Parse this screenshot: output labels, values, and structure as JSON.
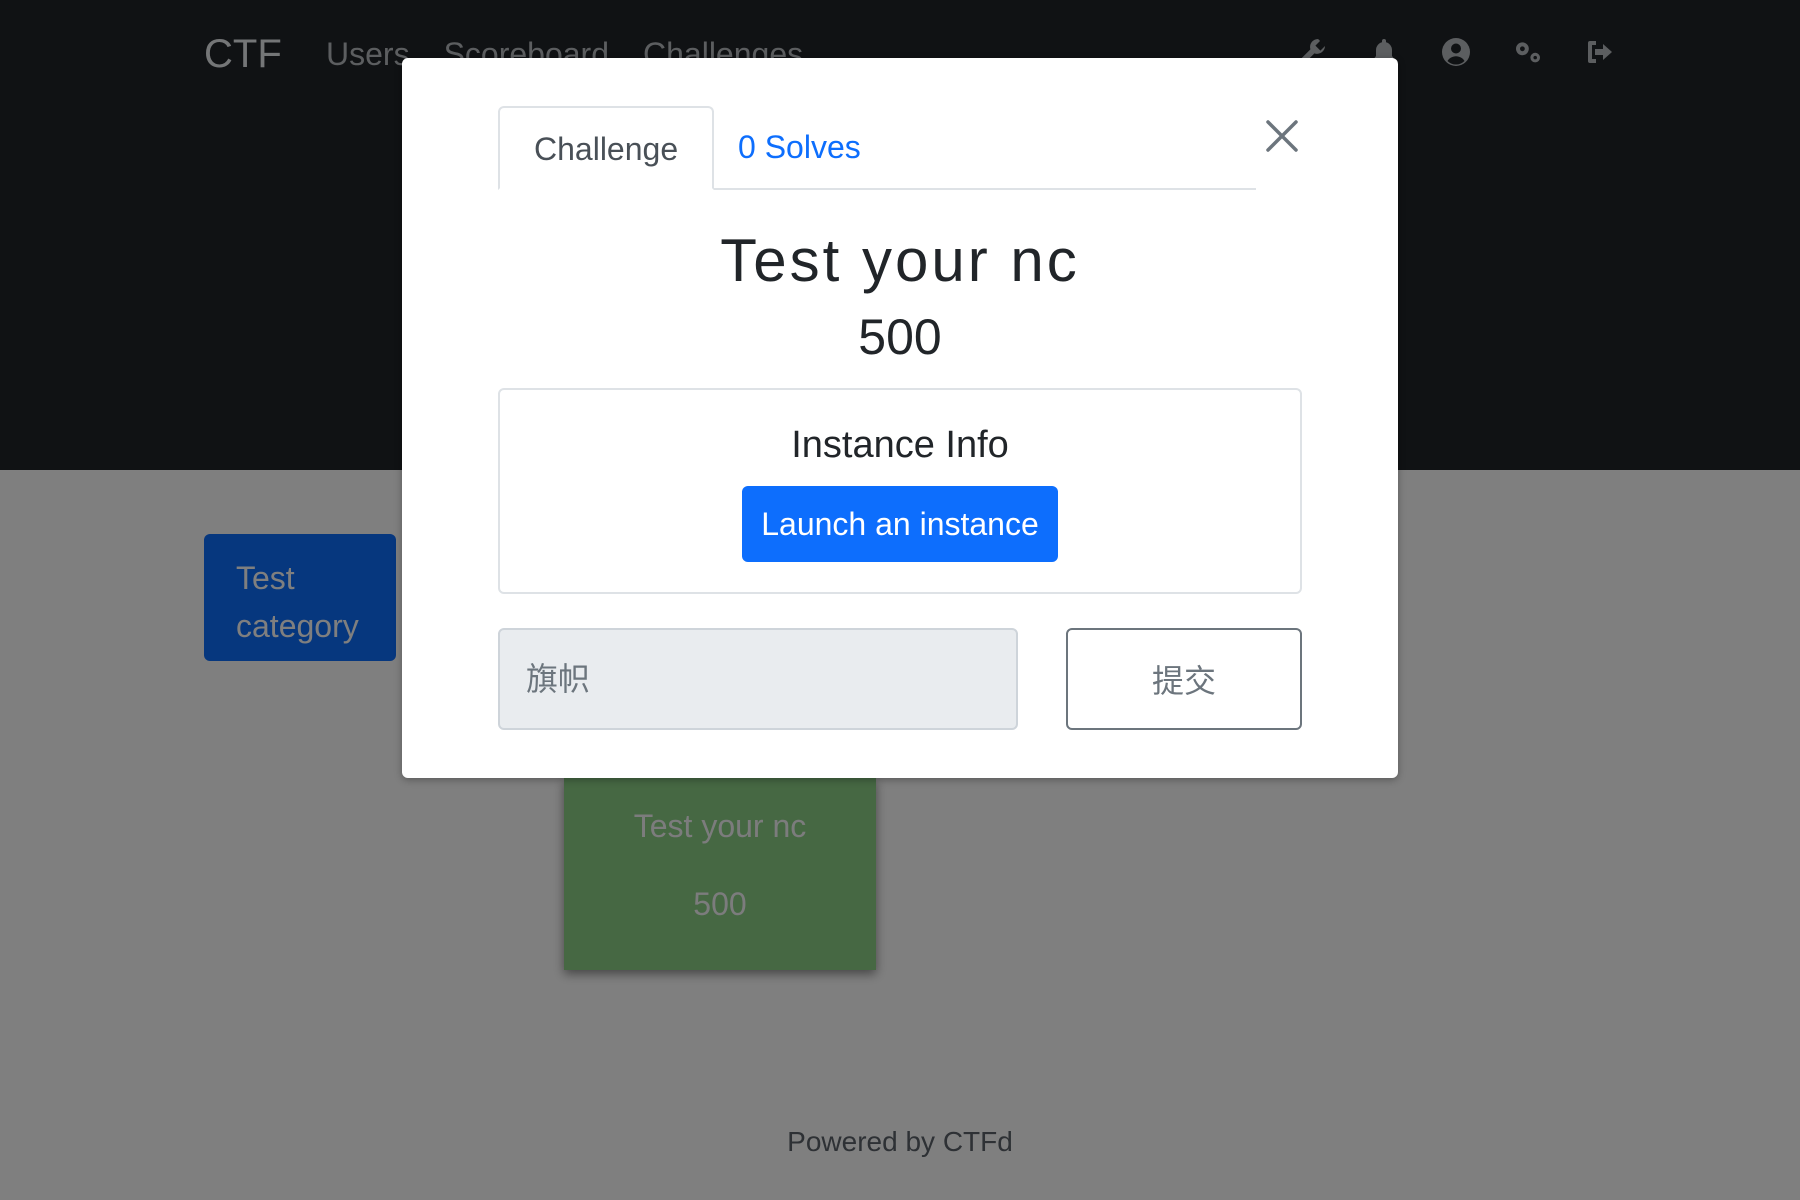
{
  "navbar": {
    "brand": "CTF",
    "links": [
      "Users",
      "Scoreboard",
      "Challenges"
    ],
    "icons": [
      "wrench-icon",
      "bell-icon",
      "user-circle-icon",
      "cogs-icon",
      "sign-out-icon"
    ]
  },
  "board": {
    "category": "Test category",
    "card": {
      "name": "Test your nc",
      "value": "500"
    }
  },
  "footer": {
    "text": "Powered by CTFd"
  },
  "modal": {
    "tabs": {
      "challenge": "Challenge",
      "solves": "0 Solves"
    },
    "challenge_name": "Test your nc",
    "challenge_value": "500",
    "instance": {
      "title": "Instance Info",
      "launch_label": "Launch an instance"
    },
    "flag_placeholder": "旗帜",
    "submit_label": "提交"
  },
  "colors": {
    "navbar_bg": "#212529",
    "primary": "#0d6efd",
    "solved_card": "#8cd087",
    "backdrop": "rgba(0,0,0,0.5)"
  }
}
